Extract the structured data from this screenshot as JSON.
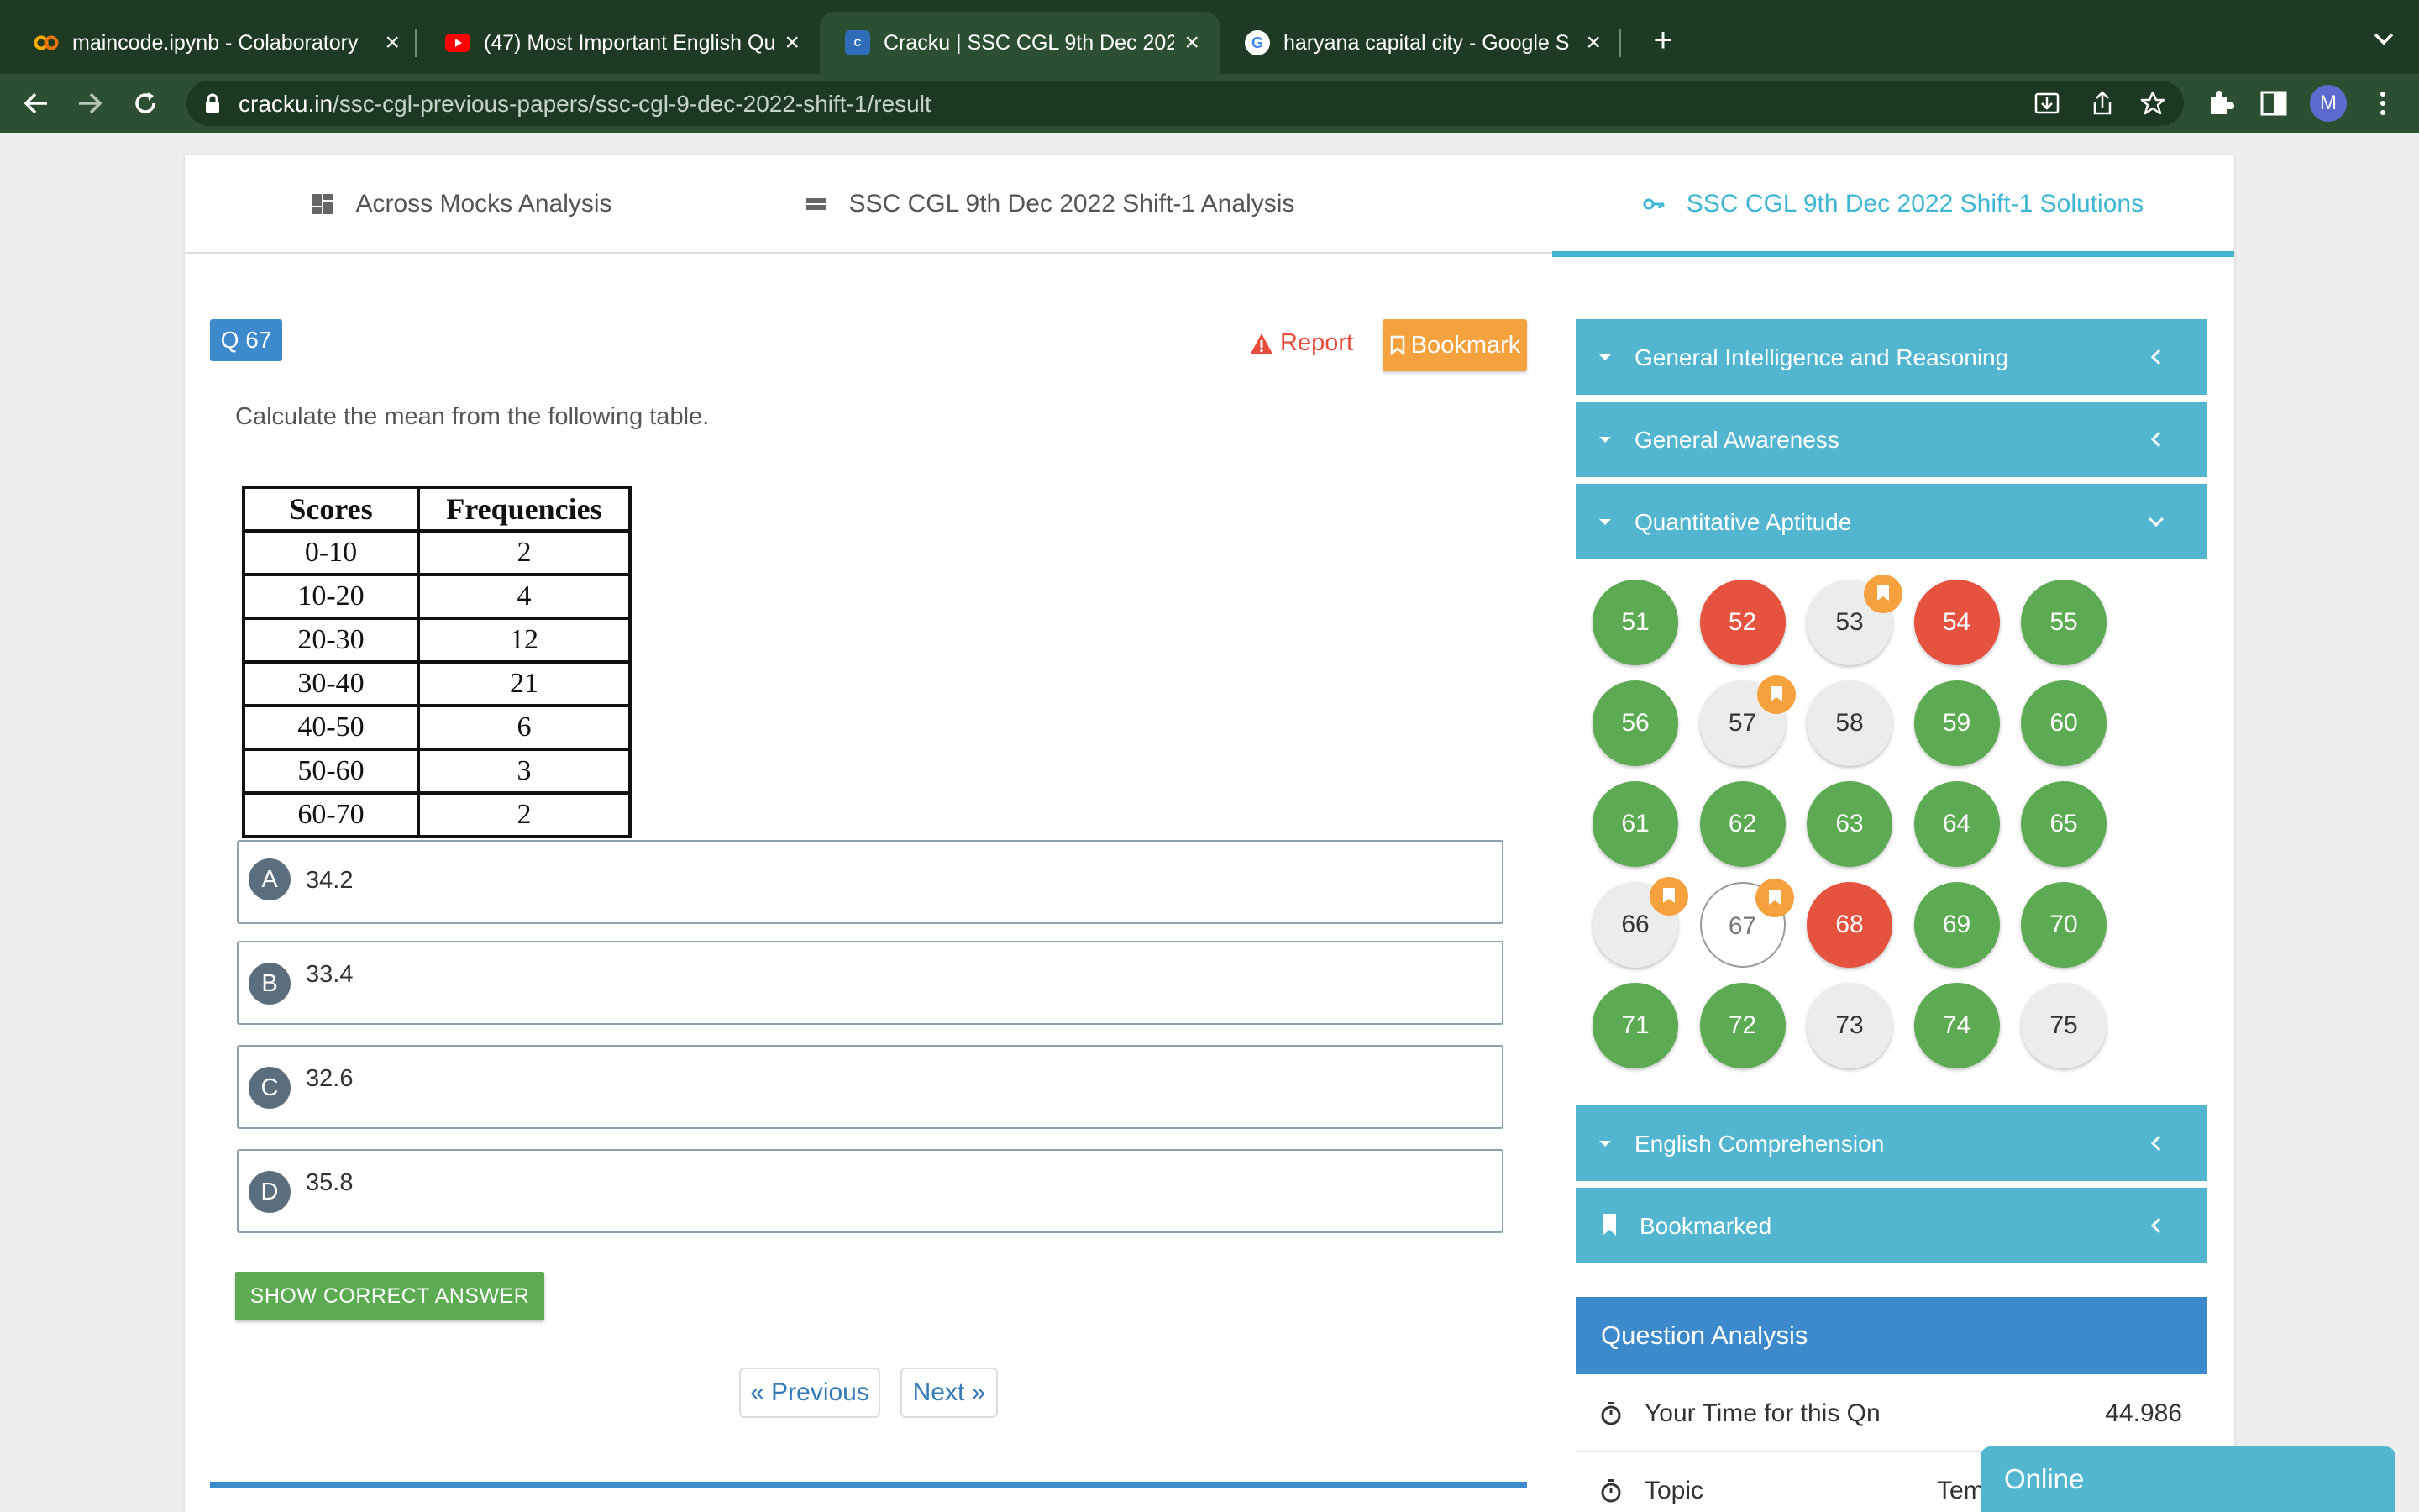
{
  "browser": {
    "tabs": [
      {
        "title": "maincode.ipynb - Colaboratory",
        "icon": "colab-icon"
      },
      {
        "title": "(47) Most Important English Qu",
        "icon": "youtube-icon"
      },
      {
        "title": "Cracku | SSC CGL 9th Dec 202",
        "icon": "cracku-icon"
      },
      {
        "title": "haryana capital city - Google S",
        "icon": "google-icon"
      }
    ],
    "active_tab": 2,
    "url_domain": "cracku.in",
    "url_path": "/ssc-cgl-previous-papers/ssc-cgl-9-dec-2022-shift-1/result",
    "profile_initial": "M"
  },
  "nav": {
    "tabs": [
      {
        "label": "Across Mocks Analysis",
        "icon": "dashboard-icon"
      },
      {
        "label": "SSC CGL 9th Dec 2022 Shift-1 Analysis",
        "icon": "list-icon"
      },
      {
        "label": "SSC CGL 9th Dec 2022 Shift-1 Solutions",
        "icon": "key-icon"
      }
    ],
    "active": 2
  },
  "question": {
    "number_label": "Q 67",
    "report_label": "Report",
    "bookmark_label": "Bookmark",
    "text": "Calculate the mean from the following table.",
    "table": {
      "headers": [
        "Scores",
        "Frequencies"
      ],
      "rows": [
        [
          "0-10",
          "2"
        ],
        [
          "10-20",
          "4"
        ],
        [
          "20-30",
          "12"
        ],
        [
          "30-40",
          "21"
        ],
        [
          "40-50",
          "6"
        ],
        [
          "50-60",
          "3"
        ],
        [
          "60-70",
          "2"
        ]
      ]
    },
    "options": [
      {
        "letter": "A",
        "text": "34.2"
      },
      {
        "letter": "B",
        "text": "33.4"
      },
      {
        "letter": "C",
        "text": "32.6"
      },
      {
        "letter": "D",
        "text": "35.8"
      }
    ],
    "show_answer_label": "SHOW CORRECT ANSWER",
    "prev_label": "« Previous",
    "next_label": "Next »"
  },
  "sections": [
    {
      "label": "General Intelligence and Reasoning",
      "expanded": false
    },
    {
      "label": "General Awareness",
      "expanded": false
    },
    {
      "label": "Quantitative Aptitude",
      "expanded": true
    },
    {
      "label": "English Comprehension",
      "expanded": false
    },
    {
      "label": "Bookmarked",
      "expanded": false
    }
  ],
  "question_grid": [
    {
      "n": "51",
      "status": "correct",
      "bookmarked": false
    },
    {
      "n": "52",
      "status": "wrong",
      "bookmarked": false
    },
    {
      "n": "53",
      "status": "unattempted",
      "bookmarked": true
    },
    {
      "n": "54",
      "status": "wrong",
      "bookmarked": false
    },
    {
      "n": "55",
      "status": "correct",
      "bookmarked": false
    },
    {
      "n": "56",
      "status": "correct",
      "bookmarked": false
    },
    {
      "n": "57",
      "status": "unattempted",
      "bookmarked": true
    },
    {
      "n": "58",
      "status": "unattempted",
      "bookmarked": false
    },
    {
      "n": "59",
      "status": "correct",
      "bookmarked": false
    },
    {
      "n": "60",
      "status": "correct",
      "bookmarked": false
    },
    {
      "n": "61",
      "status": "correct",
      "bookmarked": false
    },
    {
      "n": "62",
      "status": "correct",
      "bookmarked": false
    },
    {
      "n": "63",
      "status": "correct",
      "bookmarked": false
    },
    {
      "n": "64",
      "status": "correct",
      "bookmarked": false
    },
    {
      "n": "65",
      "status": "correct",
      "bookmarked": false
    },
    {
      "n": "66",
      "status": "unattempted",
      "bookmarked": true
    },
    {
      "n": "67",
      "status": "current",
      "bookmarked": true
    },
    {
      "n": "68",
      "status": "wrong",
      "bookmarked": false
    },
    {
      "n": "69",
      "status": "correct",
      "bookmarked": false
    },
    {
      "n": "70",
      "status": "correct",
      "bookmarked": false
    },
    {
      "n": "71",
      "status": "correct",
      "bookmarked": false
    },
    {
      "n": "72",
      "status": "correct",
      "bookmarked": false
    },
    {
      "n": "73",
      "status": "unattempted",
      "bookmarked": false
    },
    {
      "n": "74",
      "status": "correct",
      "bookmarked": false
    },
    {
      "n": "75",
      "status": "unattempted",
      "bookmarked": false
    }
  ],
  "analysis": {
    "title": "Question Analysis",
    "rows": [
      {
        "label": "Your Time for this Qn",
        "value": "44.986"
      },
      {
        "label": "Topic",
        "value": "Tem"
      }
    ]
  },
  "chat": {
    "label": "Online"
  },
  "colors": {
    "accent": "#52b6d1",
    "primary": "#3c89cc",
    "correct": "#5cab52",
    "wrong": "#e5533f",
    "bookmark": "#f5a23e"
  }
}
